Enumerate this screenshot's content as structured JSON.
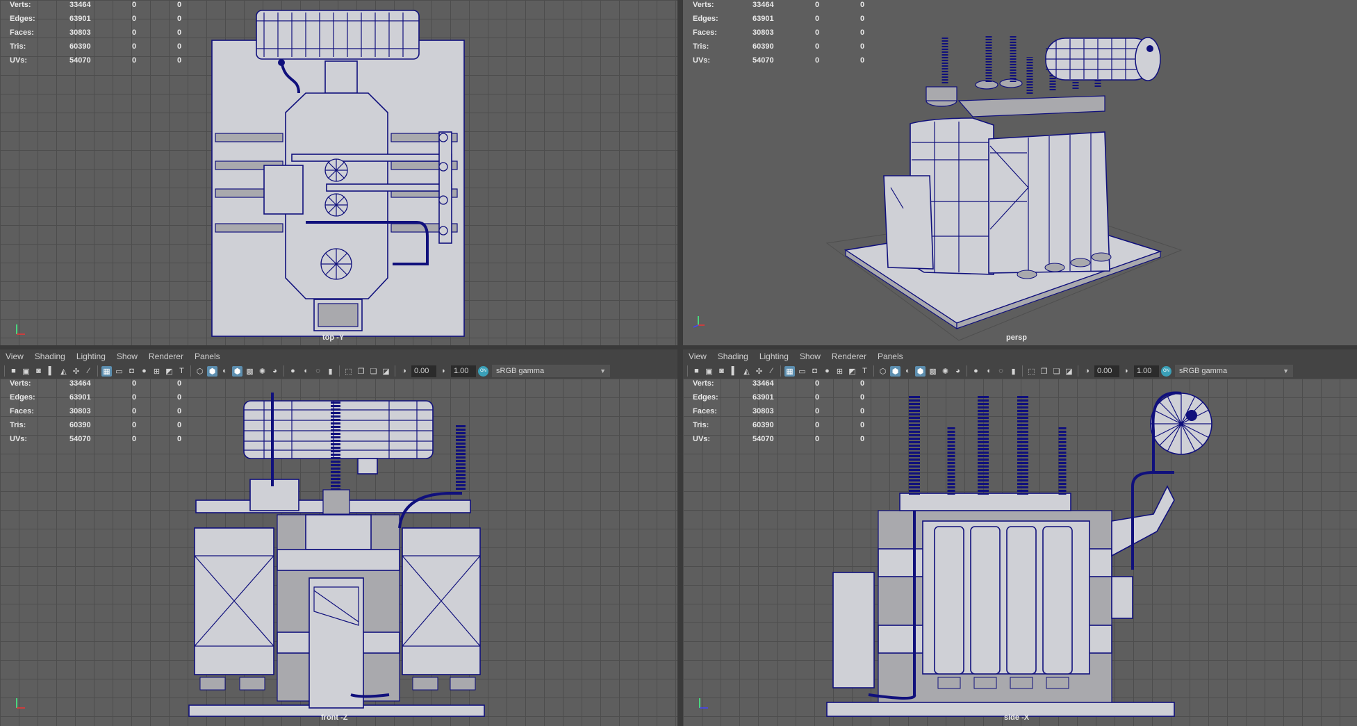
{
  "stats": [
    {
      "label": "Verts:",
      "value": "33464",
      "sel": "0",
      "extra": "0"
    },
    {
      "label": "Edges:",
      "value": "63901",
      "sel": "0",
      "extra": "0"
    },
    {
      "label": "Faces:",
      "value": "30803",
      "sel": "0",
      "extra": "0"
    },
    {
      "label": "Tris:",
      "value": "60390",
      "sel": "0",
      "extra": "0"
    },
    {
      "label": "UVs:",
      "value": "54070",
      "sel": "0",
      "extra": "0"
    }
  ],
  "viewports": {
    "top": {
      "label": "top -Y"
    },
    "persp": {
      "label": "persp"
    },
    "front": {
      "label": "front -Z"
    },
    "side": {
      "label": "side -X"
    }
  },
  "menu": [
    "View",
    "Shading",
    "Lighting",
    "Show",
    "Renderer",
    "Panels"
  ],
  "toolbar": {
    "exposure": "0.00",
    "gamma": "1.00",
    "colorspace": "sRGB gamma",
    "colorspace_toggle": "ON",
    "icons_a": [
      "camera-icon",
      "camera-lock-icon",
      "camera-attr-icon",
      "bookmark-icon",
      "image-plane-icon",
      "pivot-icon",
      "paint-icon"
    ],
    "icons_b": [
      "grid-icon",
      "film-gate-icon",
      "resolution-gate-icon",
      "gate-mask-icon",
      "field-chart-icon",
      "safe-action-icon",
      "safe-title-icon"
    ],
    "icons_c": [
      "wireframe-icon",
      "smooth-shade-icon",
      "default-material-icon",
      "wireframe-on-shaded-icon",
      "xray-icon",
      "lights-icon",
      "shadows-icon"
    ],
    "icons_d": [
      "ambient-occlusion-icon",
      "motion-blur-icon",
      "anti-alias-icon",
      "depth-of-field-icon"
    ],
    "icons_e": [
      "isolate-select-icon",
      "xray-joints-icon",
      "xray-active-icon",
      "backface-icon"
    ],
    "active_icons": [
      "grid-icon",
      "smooth-shade-icon",
      "wireframe-on-shaded-icon"
    ]
  },
  "colors": {
    "wireframe": "#10107c",
    "viewport_bg": "#5e5e5e",
    "grid": "#4d4d4d",
    "toggle_on": "#5d8fb0"
  }
}
